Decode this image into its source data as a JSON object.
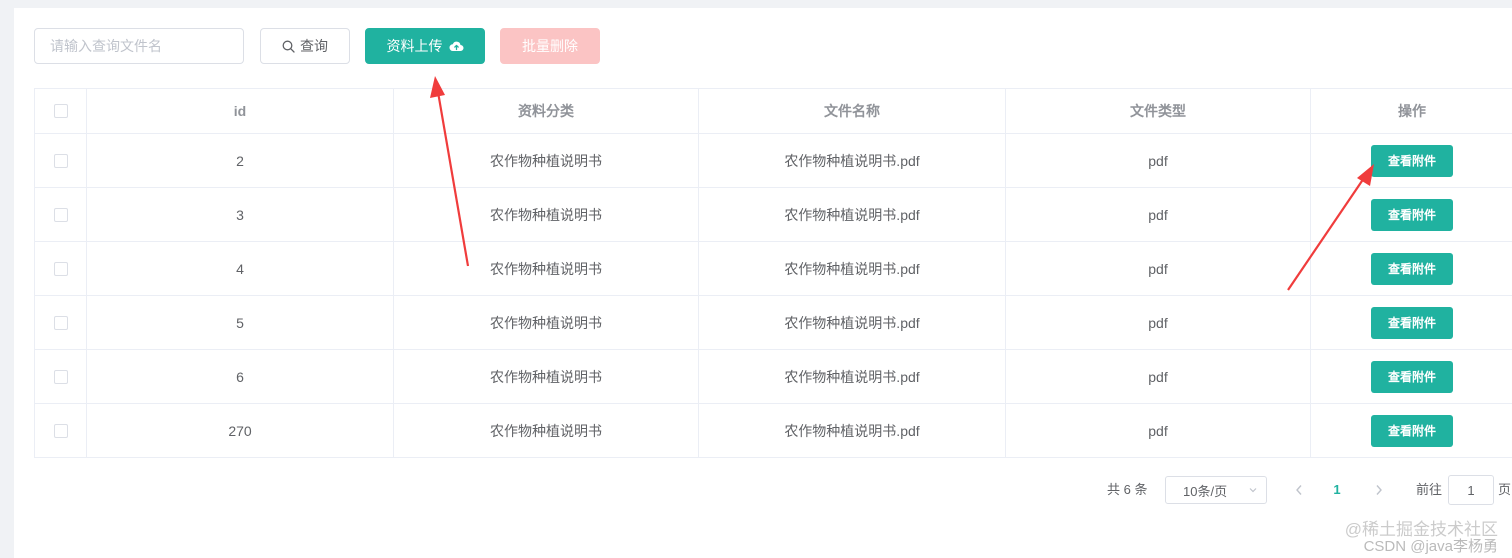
{
  "toolbar": {
    "search_placeholder": "请输入查询文件名",
    "query_label": "查询",
    "upload_label": "资料上传",
    "batch_delete_label": "批量删除"
  },
  "table": {
    "columns": [
      "id",
      "资料分类",
      "文件名称",
      "文件类型",
      "操作"
    ],
    "rows": [
      {
        "id": "2",
        "category": "农作物种植说明书",
        "filename": "农作物种植说明书.pdf",
        "filetype": "pdf",
        "action": "查看附件"
      },
      {
        "id": "3",
        "category": "农作物种植说明书",
        "filename": "农作物种植说明书.pdf",
        "filetype": "pdf",
        "action": "查看附件"
      },
      {
        "id": "4",
        "category": "农作物种植说明书",
        "filename": "农作物种植说明书.pdf",
        "filetype": "pdf",
        "action": "查看附件"
      },
      {
        "id": "5",
        "category": "农作物种植说明书",
        "filename": "农作物种植说明书.pdf",
        "filetype": "pdf",
        "action": "查看附件"
      },
      {
        "id": "6",
        "category": "农作物种植说明书",
        "filename": "农作物种植说明书.pdf",
        "filetype": "pdf",
        "action": "查看附件"
      },
      {
        "id": "270",
        "category": "农作物种植说明书",
        "filename": "农作物种植说明书.pdf",
        "filetype": "pdf",
        "action": "查看附件"
      }
    ]
  },
  "pagination": {
    "total_text": "共 6 条",
    "page_size": "10条/页",
    "current_page": "1",
    "goto_label": "前往",
    "goto_value": "1",
    "page_suffix": "页"
  },
  "watermark": {
    "line1": "@稀土掘金技术社区",
    "line2": "CSDN @java李杨勇"
  },
  "colors": {
    "primary": "#20b2a0",
    "danger_disabled": "#fbc4c4",
    "annotation_arrow": "#f03c3c"
  }
}
